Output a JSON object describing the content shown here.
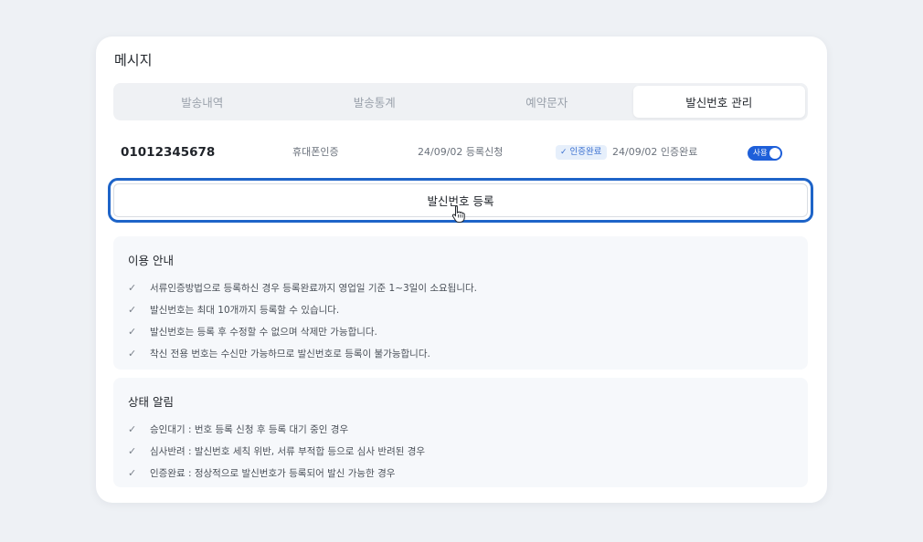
{
  "card": {
    "title": "메시지"
  },
  "tabs": [
    {
      "label": "발송내역"
    },
    {
      "label": "발송통계"
    },
    {
      "label": "예약문자"
    },
    {
      "label": "발신번호 관리",
      "active": true
    }
  ],
  "number_row": {
    "phone": "01012345678",
    "method": "휴대폰인증",
    "request": "24/09/02 등록신청",
    "badge": "인증완료",
    "verified": "24/09/02 인증완료",
    "toggle_label": "사용",
    "toggle_on": true
  },
  "register_button": {
    "label": "발신번호 등록"
  },
  "usage": {
    "title": "이용 안내",
    "items": [
      "서류인증방법으로 등록하신 경우 등록완료까지 영업일 기준 1~3일이 소요됩니다.",
      "발신번호는 최대 10개까지 등록할 수 있습니다.",
      "발신번호는 등록 후 수정할 수 없으며 삭제만 가능합니다.",
      "착신 전용 번호는 수신만 가능하므로 발신번호로 등록이 불가능합니다."
    ]
  },
  "status": {
    "title": "상태 알림",
    "items": [
      "승인대기 : 번호 등록 신청 후 등록 대기 중인 경우",
      "심사반려 : 발신번호 세칙 위반, 서류 부적합 등으로 심사 반려된 경우",
      "인증완료 : 정상적으로 발신번호가 등록되어 발신 가능한 경우"
    ]
  },
  "colors": {
    "accent": "#1e5fd9",
    "focus_outline": "#1e64c8",
    "badge_bg": "#e6effb"
  },
  "icons": {
    "check": "check-icon",
    "cursor": "hand-pointer-icon"
  }
}
